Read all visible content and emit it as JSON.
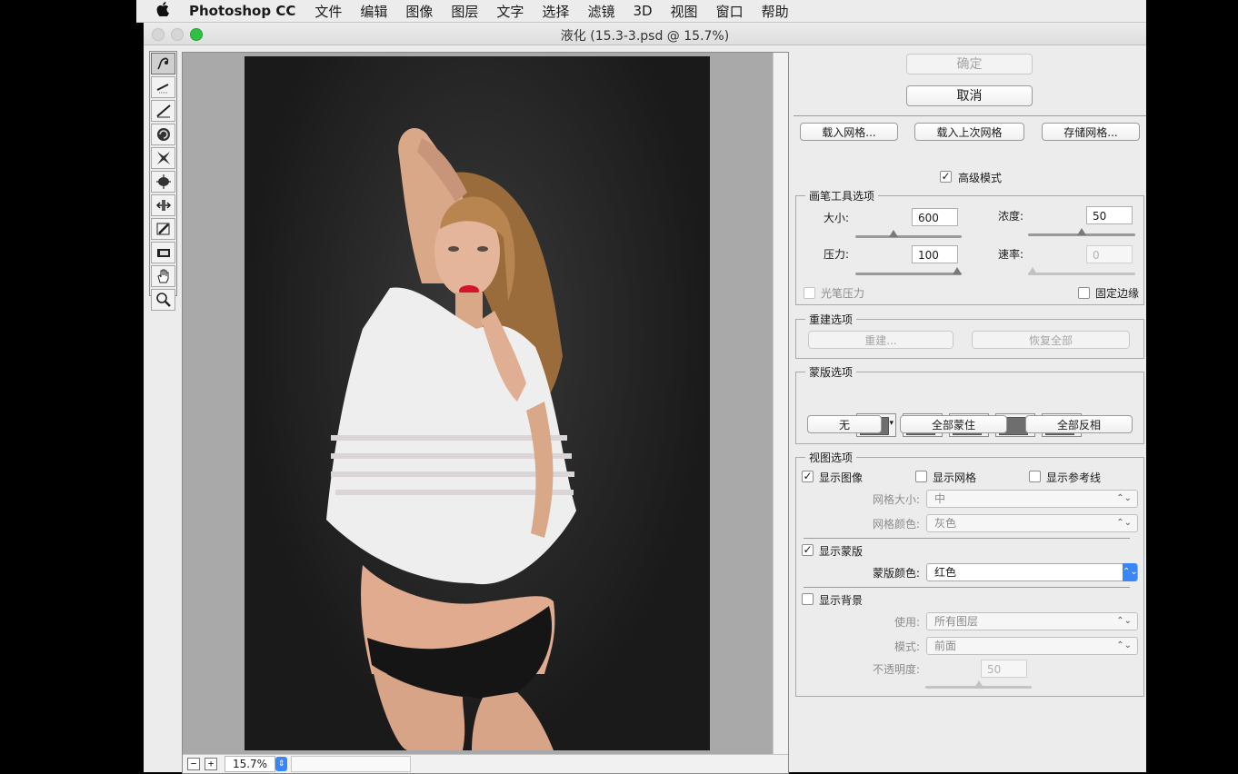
{
  "menubar": {
    "app_name": "Photoshop CC",
    "items": [
      "文件",
      "编辑",
      "图像",
      "图层",
      "文字",
      "选择",
      "滤镜",
      "3D",
      "视图",
      "窗口",
      "帮助"
    ]
  },
  "window": {
    "title": "液化 (15.3-3.psd @ 15.7%)"
  },
  "tools": [
    "forward-warp-icon",
    "reconstruct-icon",
    "smooth-icon",
    "twirl-icon",
    "pucker-icon",
    "bloat-icon",
    "push-left-icon",
    "freeze-mask-icon",
    "thaw-mask-icon",
    "hand-icon",
    "zoom-icon"
  ],
  "canvas": {
    "zoom": "15.7%",
    "zoom_minus": "−",
    "zoom_plus": "+",
    "stepper": "⇕"
  },
  "actions": {
    "ok": "确定",
    "cancel": "取消"
  },
  "mesh": {
    "load": "载入网格...",
    "load_last": "载入上次网格",
    "save": "存储网格...",
    "advanced_mode": "高级模式"
  },
  "brush": {
    "title": "画笔工具选项",
    "size_label": "大小:",
    "size": "600",
    "density_label": "浓度:",
    "density": "50",
    "pressure_label": "压力:",
    "pressure": "100",
    "rate_label": "速率:",
    "rate": "0",
    "stylus_label": "光笔压力",
    "pin_edges_label": "固定边缘"
  },
  "reconstruct": {
    "title": "重建选项",
    "reconstruct": "重建...",
    "restore_all": "恢复全部"
  },
  "mask": {
    "title": "蒙版选项",
    "none": "无",
    "mask_all": "全部蒙住",
    "invert_all": "全部反相",
    "dropdown": "▾"
  },
  "view": {
    "title": "视图选项",
    "show_image": "显示图像",
    "show_mesh": "显示网格",
    "show_guides": "显示参考线",
    "mesh_size_label": "网格大小:",
    "mesh_size": "中",
    "mesh_color_label": "网格颜色:",
    "mesh_color": "灰色",
    "show_mask": "显示蒙版",
    "mask_color_label": "蒙版颜色:",
    "mask_color": "红色",
    "show_backdrop": "显示背景",
    "use_label": "使用:",
    "use": "所有图层",
    "mode_label": "模式:",
    "mode": "前面",
    "opacity_label": "不透明度:",
    "opacity": "50",
    "check": "✓",
    "updown": "⌃⌄"
  }
}
